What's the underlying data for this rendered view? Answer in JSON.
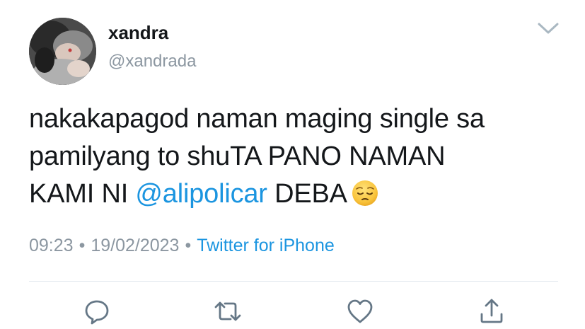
{
  "user": {
    "display_name": "xandra",
    "handle": "@xandrada",
    "avatar_icon": "profile-photo"
  },
  "tweet": {
    "line1": "nakakapagod naman maging single sa",
    "line2": "pamilyang to shuTA PANO NAMAN",
    "line3_prefix": "KAMI NI ",
    "mention": "@alipolicar",
    "line3_suffix": " DEBA",
    "emoji": "pensive-face"
  },
  "meta": {
    "time": "09:23",
    "separator": "•",
    "date": "19/02/2023",
    "source": "Twitter for iPhone"
  },
  "actions": {
    "reply_icon": "reply-icon",
    "retweet_icon": "retweet-icon",
    "like_icon": "heart-icon",
    "share_icon": "share-icon"
  },
  "colors": {
    "link": "#1b95e0",
    "secondary_text": "#8c97a1",
    "icon": "#657786",
    "divider": "#e1e8ed"
  }
}
